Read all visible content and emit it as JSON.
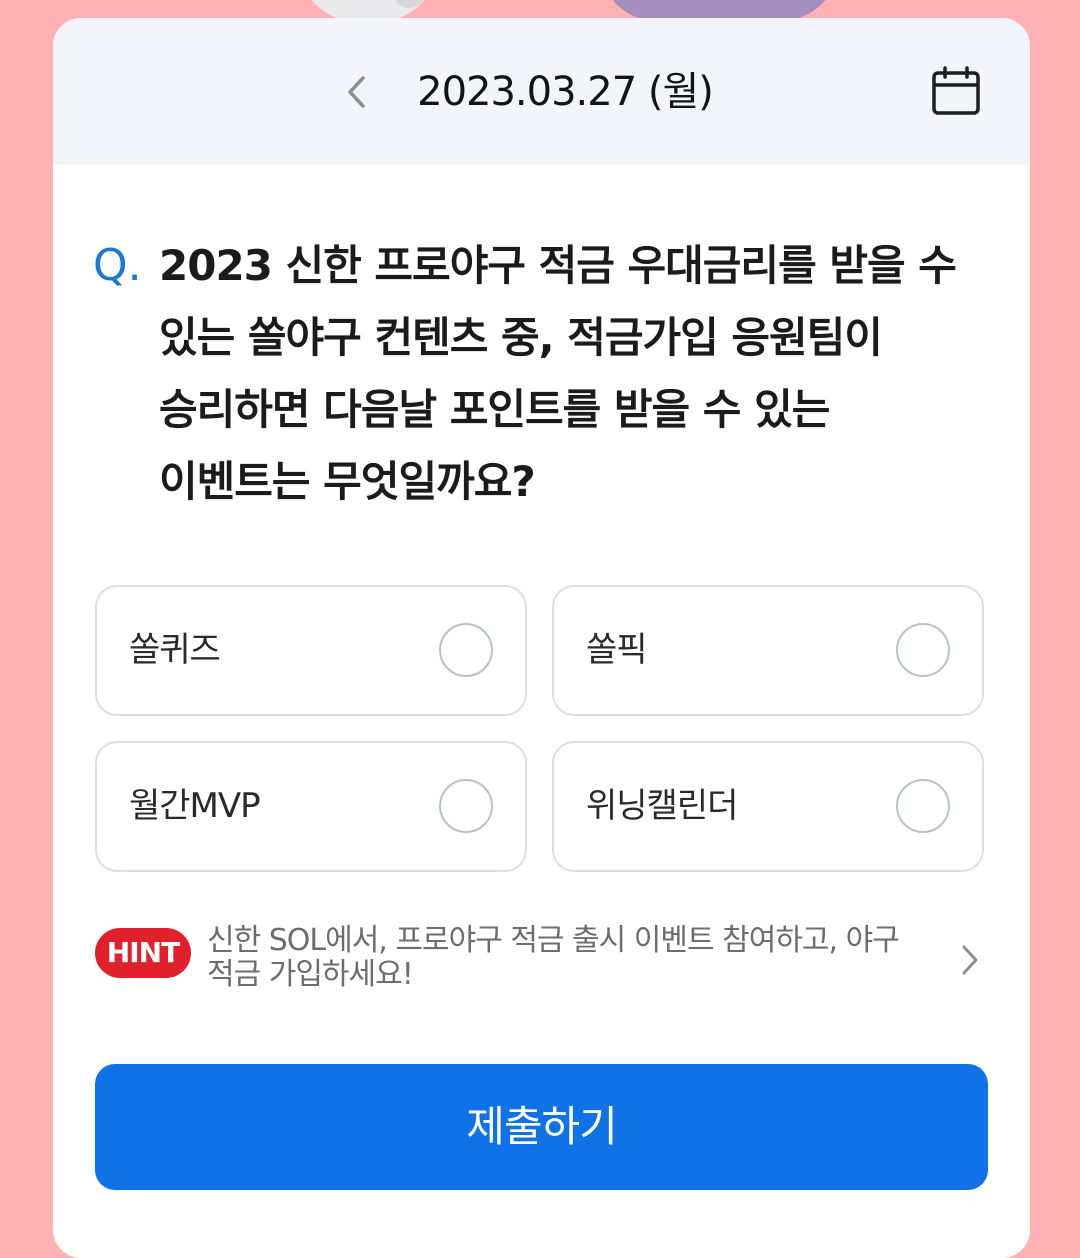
{
  "header": {
    "date": "2023.03.27 (월)",
    "prev_icon": "chevron-left-icon",
    "calendar_icon": "calendar-icon"
  },
  "question": {
    "prefix": "Q.",
    "text": "2023 신한 프로야구 적금 우대금리를 받을 수 있는 쏠야구 컨텐츠 중, 적금가입 응원팀이 승리하면 다음날 포인트를 받을 수 있는 이벤트는 무엇일까요?"
  },
  "options": [
    {
      "label": "쏠퀴즈",
      "selected": false
    },
    {
      "label": "쏠픽",
      "selected": false
    },
    {
      "label": "월간MVP",
      "selected": false
    },
    {
      "label": "위닝캘린더",
      "selected": false
    }
  ],
  "hint": {
    "badge": "HINT",
    "text": "신한 SOL에서, 프로야구 적금 출시 이벤트 참여하고, 야구 적금 가입하세요!",
    "chevron_icon": "chevron-right-icon"
  },
  "submit": {
    "label": "제출하기"
  },
  "colors": {
    "background": "#ffb1b4",
    "accent": "#0f72e6",
    "question_mark": "#1b78db",
    "hint_badge": "#e0202a"
  }
}
